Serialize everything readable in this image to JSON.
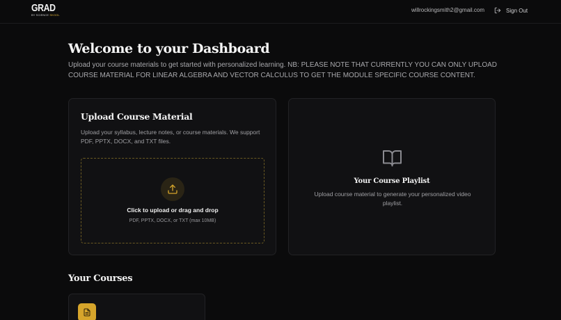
{
  "header": {
    "logo_main": "GRAD",
    "logo_sub_prefix": "BY SCIENCE",
    "logo_sub_accent": "SKOOL",
    "user_email": "willrockingsmith2@gmail.com",
    "signout_label": "Sign Out",
    "signout_icon": "log-out-icon"
  },
  "main": {
    "title": "Welcome to your Dashboard",
    "intro": "Upload your course materials to get started with personalized learning. NB: PLEASE NOTE THAT CURRENTLY YOU CAN ONLY UPLOAD COURSE MATERIAL FOR LINEAR ALGEBRA AND VECTOR CALCULUS TO GET THE MODULE SPECIFIC COURSE CONTENT."
  },
  "upload_card": {
    "title": "Upload Course Material",
    "description": "Upload your syllabus, lecture notes, or course materials. We support PDF, PPTX, DOCX, and TXT files.",
    "dropzone_title": "Click to upload or drag and drop",
    "dropzone_subtitle": "PDF, PPTX, DOCX, or TXT (max 10MB)",
    "icon": "upload-icon"
  },
  "playlist_card": {
    "title": "Your Course Playlist",
    "description": "Upload course material to generate your personalized video playlist.",
    "icon": "book-open-icon"
  },
  "courses": {
    "title": "Your Courses",
    "items": [
      {
        "icon": "file-text-icon"
      }
    ]
  },
  "colors": {
    "background": "#0b0b0c",
    "card": "#111113",
    "accent": "#d6a52b",
    "dropzone_border": "#6b5a22"
  }
}
